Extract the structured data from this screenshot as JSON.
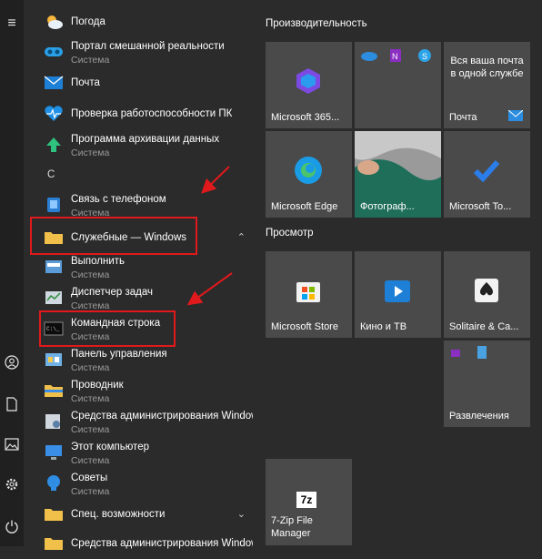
{
  "rail": {
    "menu_glyph": "≡",
    "bottom_icons": [
      "user-icon",
      "document-icon",
      "pictures-icon",
      "settings-icon",
      "power-icon"
    ]
  },
  "applist": {
    "items": [
      {
        "name": "Погода",
        "sub": ""
      },
      {
        "name": "Портал смешанной реальности",
        "sub": "Система"
      },
      {
        "name": "Почта",
        "sub": ""
      },
      {
        "name": "Проверка работоспособности ПК",
        "sub": ""
      },
      {
        "name": "Программа архивации данных",
        "sub": "Система"
      },
      {
        "name": "Связь с телефоном",
        "sub": "Система"
      },
      {
        "name": "Служебные — Windows",
        "sub": ""
      },
      {
        "name": "Выполнить",
        "sub": "Система"
      },
      {
        "name": "Диспетчер задач",
        "sub": "Система"
      },
      {
        "name": "Командная строка",
        "sub": "Система"
      },
      {
        "name": "Панель управления",
        "sub": "Система"
      },
      {
        "name": "Проводник",
        "sub": "Система"
      },
      {
        "name": "Средства администрирования Windows",
        "sub": "Система"
      },
      {
        "name": "Этот компьютер",
        "sub": "Система"
      },
      {
        "name": "Советы",
        "sub": "Система"
      },
      {
        "name": "Спец. возможности",
        "sub": ""
      },
      {
        "name": "Средства администрирования Windows",
        "sub": ""
      }
    ],
    "section_letter": "С",
    "chevron_up": "⌃",
    "chevron_down": "⌄"
  },
  "tiles": {
    "group1_title": "Производительность",
    "group2_title": "Просмотр",
    "items": [
      {
        "label": "Microsoft 365..."
      },
      {
        "label": ""
      },
      {
        "label": "Почта",
        "text": "Вся ваша почта в одной службе"
      },
      {
        "label": "Microsoft Edge"
      },
      {
        "label": "Фотограф..."
      },
      {
        "label": "Microsoft To..."
      },
      {
        "label": "Microsoft Store"
      },
      {
        "label": "Кино и ТВ"
      },
      {
        "label": "Solitaire & Ca..."
      },
      {
        "label": "Развлечения"
      },
      {
        "label": "7-Zip File Manager"
      }
    ]
  },
  "colors": {
    "highlight": "#e0191c",
    "accent": "#1e7fd6"
  }
}
